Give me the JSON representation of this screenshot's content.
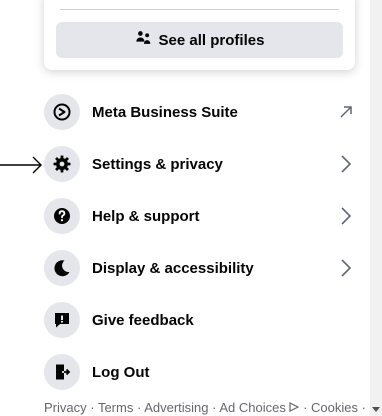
{
  "profiles": {
    "see_all_label": "See all profiles",
    "icon": "people-icon"
  },
  "menu": [
    {
      "label": "Meta Business Suite",
      "icon": "meta-business-suite-icon",
      "right_icon": "external-link-icon"
    },
    {
      "label": "Settings & privacy",
      "icon": "gear-icon",
      "right_icon": "chevron-right-icon"
    },
    {
      "label": "Help & support",
      "icon": "question-icon",
      "right_icon": "chevron-right-icon"
    },
    {
      "label": "Display & accessibility",
      "icon": "moon-icon",
      "right_icon": "chevron-right-icon"
    },
    {
      "label": "Give feedback",
      "icon": "feedback-icon",
      "right_icon": ""
    },
    {
      "label": "Log Out",
      "icon": "logout-icon",
      "right_icon": ""
    }
  ],
  "footer": {
    "privacy": "Privacy",
    "terms": "Terms",
    "advertising": "Advertising",
    "ad_choices": "Ad Choices",
    "cookies": "Cookies",
    "separator": " · "
  },
  "colors": {
    "icon_bg": "#e4e6eb",
    "text": "#050505",
    "secondary_text": "#65676b"
  }
}
